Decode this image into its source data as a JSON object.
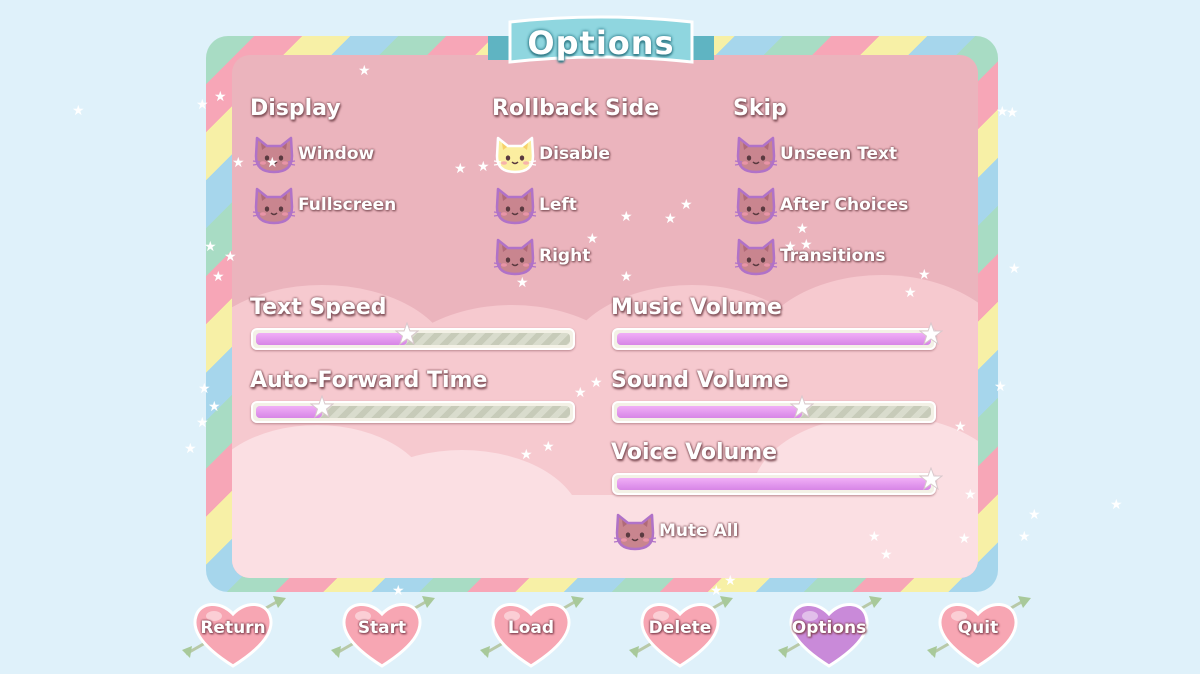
{
  "title": "Options",
  "display": {
    "heading": "Display",
    "options": [
      {
        "label": "Window",
        "selected": false
      },
      {
        "label": "Fullscreen",
        "selected": false
      }
    ]
  },
  "rollback": {
    "heading": "Rollback Side",
    "options": [
      {
        "label": "Disable",
        "selected": true
      },
      {
        "label": "Left",
        "selected": false
      },
      {
        "label": "Right",
        "selected": false
      }
    ]
  },
  "skip": {
    "heading": "Skip",
    "options": [
      {
        "label": "Unseen Text",
        "selected": false
      },
      {
        "label": "After Choices",
        "selected": false
      },
      {
        "label": "Transitions",
        "selected": false
      }
    ]
  },
  "sliders": {
    "text_speed": {
      "label": "Text Speed",
      "value": 0.48
    },
    "auto_forward": {
      "label": "Auto-Forward Time",
      "value": 0.21
    },
    "music_volume": {
      "label": "Music Volume",
      "value": 1.0
    },
    "sound_volume": {
      "label": "Sound Volume",
      "value": 0.59
    },
    "voice_volume": {
      "label": "Voice Volume",
      "value": 1.0
    }
  },
  "mute_all": {
    "label": "Mute All",
    "selected": false
  },
  "nav": [
    {
      "label": "Return",
      "active": false
    },
    {
      "label": "Start",
      "active": false
    },
    {
      "label": "Load",
      "active": false
    },
    {
      "label": "Delete",
      "active": false
    },
    {
      "label": "Options",
      "active": true
    },
    {
      "label": "Quit",
      "active": false
    }
  ],
  "colors": {
    "cat_unselected": "#c9858f",
    "cat_selected": "#fbeea0",
    "heart": "#f7a6b3",
    "heart_active": "#c98ad9",
    "slider_fill": "#e39bf0",
    "banner": "#7fcfd9"
  }
}
